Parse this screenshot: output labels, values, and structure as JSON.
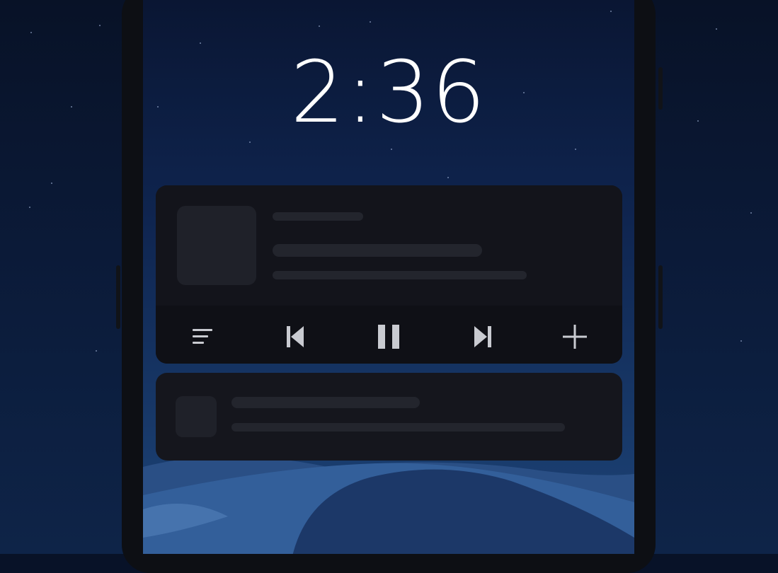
{
  "lockscreen": {
    "time": "2:36"
  },
  "media_player": {
    "controls": {
      "queue": "queue-icon",
      "previous": "skip-previous-icon",
      "play_pause": "pause-icon",
      "next": "skip-next-icon",
      "add": "add-icon"
    }
  },
  "colors": {
    "background": "#0b1a38",
    "card": "#121319",
    "skeleton": "#23252d",
    "icon": "#c9cbd1",
    "clock": "#ffffff"
  }
}
